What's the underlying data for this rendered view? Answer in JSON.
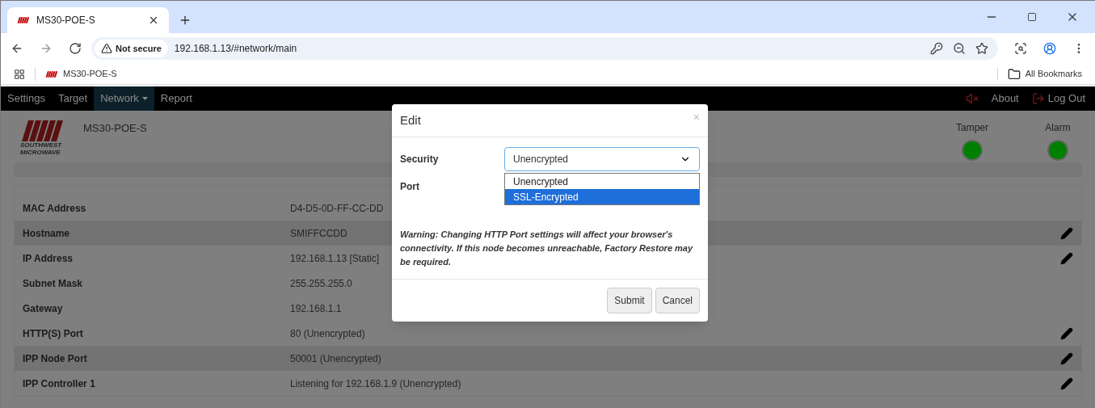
{
  "browser": {
    "tab_title": "MS30-POE-S",
    "security_label": "Not secure",
    "url": "192.168.1.13/#network/main",
    "bookmarks": [
      {
        "label": "MS30-POE-S"
      }
    ],
    "all_bookmarks": "All Bookmarks"
  },
  "navbar": {
    "items": [
      {
        "label": "Settings",
        "selected": false,
        "dropdown": false
      },
      {
        "label": "Target",
        "selected": false,
        "dropdown": false
      },
      {
        "label": "Network",
        "selected": true,
        "dropdown": true
      },
      {
        "label": "Report",
        "selected": false,
        "dropdown": false
      }
    ],
    "muted": true,
    "about": "About",
    "logout": "Log Out"
  },
  "header": {
    "logo_text": "SOUTHWEST MICROWAVE",
    "device": "MS30-POE-S",
    "indicators": [
      {
        "label": "Tamper",
        "color": "#008000"
      },
      {
        "label": "Alarm",
        "color": "#008000"
      }
    ]
  },
  "table": {
    "rows": [
      {
        "label": "MAC Address",
        "value": "D4-D5-0D-FF-CC-DD",
        "editable": false,
        "highlighted": false
      },
      {
        "label": "Hostname",
        "value": "SMIFFCCDD",
        "editable": true,
        "highlighted": true
      },
      {
        "label": "IP Address",
        "value": "192.168.1.13 [Static]",
        "editable": true,
        "highlighted": false
      },
      {
        "label": "Subnet Mask",
        "value": "255.255.255.0",
        "editable": false,
        "highlighted": false
      },
      {
        "label": "Gateway",
        "value": "192.168.1.1",
        "editable": false,
        "highlighted": false
      },
      {
        "label": "HTTP(S) Port",
        "value": "80 (Unencrypted)",
        "editable": true,
        "highlighted": false
      },
      {
        "label": "IPP Node Port",
        "value": "50001 (Unencrypted)",
        "editable": true,
        "highlighted": true
      },
      {
        "label": "IPP Controller 1",
        "value": "Listening for 192.168.1.9 (Unencrypted)",
        "editable": true,
        "highlighted": false
      }
    ]
  },
  "modal": {
    "title": "Edit",
    "close": "×",
    "security_label": "Security",
    "security_value": "Unencrypted",
    "port_label": "Port",
    "options": [
      {
        "label": "Unencrypted",
        "selected": false
      },
      {
        "label": "SSL-Encrypted",
        "selected": true
      }
    ],
    "warning": "Warning: Changing HTTP Port settings will affect your browser's connectivity. If this node becomes unreachable, Factory Restore may be required.",
    "buttons": [
      "Submit",
      "Cancel"
    ]
  }
}
